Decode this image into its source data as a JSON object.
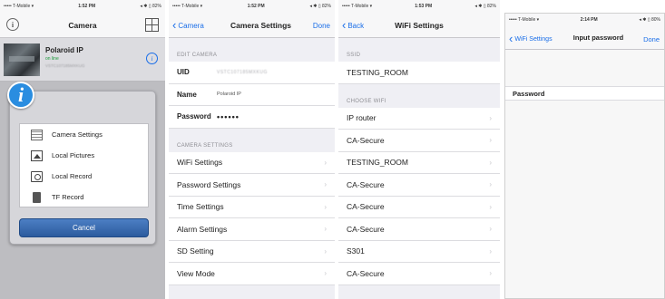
{
  "panel1": {
    "status": {
      "carrier": "••••• T-Mobile ▾",
      "time": "1:52 PM",
      "battery": "◂ ✱ ▯ 82%"
    },
    "nav": {
      "title": "Camera"
    },
    "camera": {
      "name": "Polaroid IP",
      "status": "on line",
      "uid": "VSTC107185MXKUG"
    },
    "menu": {
      "items": [
        {
          "label": "Camera Settings",
          "icon": "settings-icon"
        },
        {
          "label": "Local Pictures",
          "icon": "pictures-icon"
        },
        {
          "label": "Local Record",
          "icon": "record-icon"
        },
        {
          "label": "TF Record",
          "icon": "sd-card-icon"
        }
      ],
      "cancel": "Cancel"
    }
  },
  "panel2": {
    "status": {
      "carrier": "••••• T-Mobile ▾",
      "time": "1:52 PM",
      "battery": "◂ ✱ ▯ 82%"
    },
    "nav": {
      "back": "Camera",
      "title": "Camera Settings",
      "done": "Done"
    },
    "edit_section": "EDIT CAMERA",
    "fields": [
      {
        "label": "UID",
        "value": "VSTC107185MXKUG"
      },
      {
        "label": "Name",
        "value": "Polaroid IP"
      },
      {
        "label": "Password",
        "value": "••••••"
      }
    ],
    "settings_section": "CAMERA SETTINGS",
    "settings": [
      "WiFi Settings",
      "Password Settings",
      "Time Settings",
      "Alarm Settings",
      "SD Setting",
      "View Mode"
    ]
  },
  "panel3": {
    "status": {
      "carrier": "••••• T-Mobile ▾",
      "time": "1:53 PM",
      "battery": "◂ ✱ ▯ 82%"
    },
    "nav": {
      "back": "Back",
      "title": "WiFi Settings"
    },
    "ssid_section": "SSID",
    "ssid": "TESTING_ROOM",
    "choose_section": "CHOOSE WIFI",
    "networks": [
      "IP router",
      "CA-Secure",
      "TESTING_ROOM",
      "CA-Secure",
      "CA-Secure",
      "CA-Secure",
      "S301",
      "CA-Secure"
    ]
  },
  "panel4": {
    "status": {
      "carrier": "••••• T-Mobile ▾",
      "time": "2:14 PM",
      "battery": "◂ ✱ ▯ 80%"
    },
    "nav": {
      "back": "WiFi Settings",
      "title": "Input password",
      "done": "Done"
    },
    "password_label": "Password",
    "password_value": ""
  }
}
